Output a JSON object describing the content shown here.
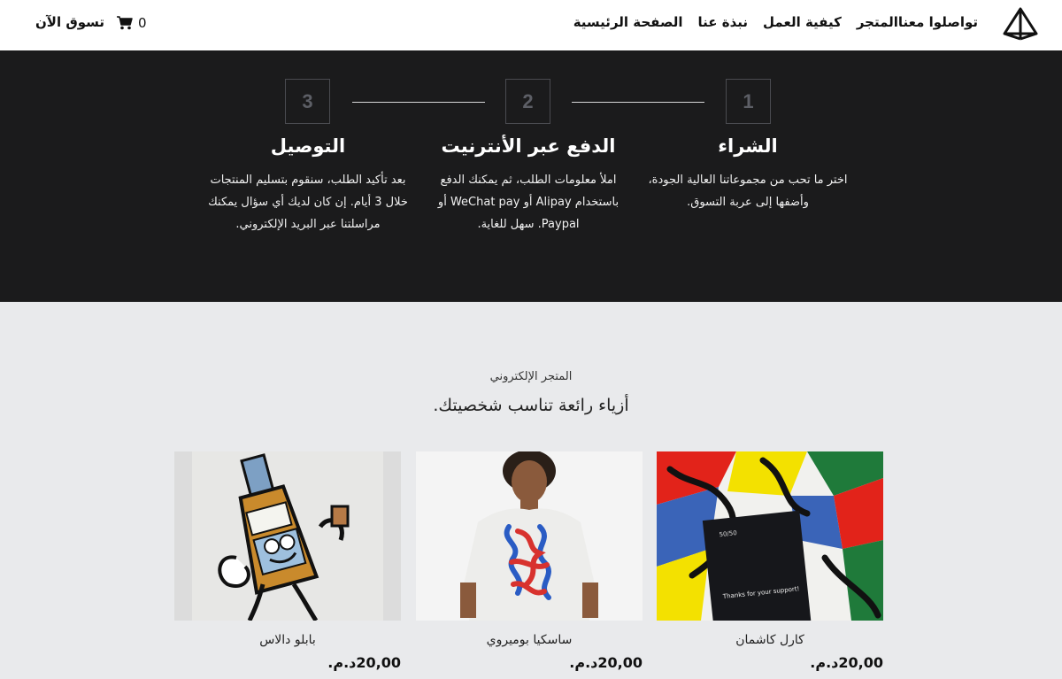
{
  "header": {
    "nav": [
      {
        "label": "الصفحة الرئيسية"
      },
      {
        "label": "نبذة عنا"
      },
      {
        "label": "كيفية العمل"
      },
      {
        "label": "المتجر"
      },
      {
        "label": "تواصلوا معنا"
      }
    ],
    "cart_count": "0",
    "shop_now": "تسوق الآن",
    "logo_icon": "triangle-logo-icon",
    "cart_icon": "cart-icon"
  },
  "steps": [
    {
      "number": "1",
      "title": "الشراء",
      "description_lines": [
        "اختر ما تحب من مجموعاتنا العالية الجودة،",
        "وأضفها إلى عربة التسوق."
      ]
    },
    {
      "number": "2",
      "title": "الدفع عبر الأنترنيت",
      "description_lines": [
        "املأ معلومات الطلب، ثم يمكنك الدفع",
        "باستخدام Alipay أو WeChat pay أو",
        "Paypal. سهل للغاية."
      ]
    },
    {
      "number": "3",
      "title": "التوصيل",
      "description_lines": [
        "بعد تأكيد الطلب، سنقوم بتسليم المنتجات",
        "خلال 3 أيام. إن كان لديك أي سؤال يمكنك",
        "مراسلتنا عبر البريد الإلكتروني."
      ]
    }
  ],
  "shop": {
    "kicker": "المتجر الإلكتروني",
    "heading": "أزياء رائعة تناسب شخصيتك.",
    "products": [
      {
        "name": "كارل كاشمان",
        "price": "20,00د.م."
      },
      {
        "name": "ساسكيا بوميروي",
        "price": "20,00د.م."
      },
      {
        "name": "بابلو دالاس",
        "price": "20,00د.م."
      }
    ],
    "card_text": {
      "brand": "50/50",
      "thanks": "Thanks for your support!"
    }
  },
  "colors": {
    "dark_band": "#1b1b1c",
    "page_bg": "#e9eaec",
    "header_bg": "#ffffff"
  }
}
